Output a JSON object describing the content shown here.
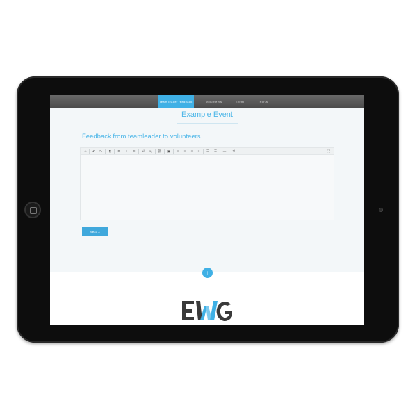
{
  "nav": {
    "items": [
      {
        "label": "Team leader feedback",
        "active": true
      },
      {
        "label": "Volunteers",
        "active": false
      },
      {
        "label": "Event",
        "active": false
      },
      {
        "label": "Portal",
        "active": false
      }
    ]
  },
  "page": {
    "event_title": "Example Event",
    "section_heading": "Feedback from teamleader to volunteers"
  },
  "editor": {
    "toolbar_icons": [
      "code-view-icon",
      "undo-icon",
      "redo-icon",
      "paragraph-icon",
      "bold-icon",
      "italic-icon",
      "strikethrough-icon",
      "superscript-icon",
      "subscript-icon",
      "link-icon",
      "image-icon",
      "align-left-icon",
      "align-center-icon",
      "align-right-icon",
      "align-justify-icon",
      "unordered-list-icon",
      "ordered-list-icon",
      "horizontal-rule-icon",
      "clear-format-icon",
      "fullscreen-icon"
    ],
    "toolbar_glyphs": {
      "code": "‹›",
      "undo": "↶",
      "redo": "↷",
      "paragraph": "¶",
      "bold": "B",
      "italic": "I",
      "strike": "S",
      "superscript": "x²",
      "subscript": "x₂",
      "link": "⛓",
      "image": "▣",
      "align_left": "≡",
      "align_center": "≡",
      "align_right": "≡",
      "align_justify": "≡",
      "ul": "☰",
      "ol": "☰",
      "hr": "—",
      "clear": "T̸",
      "fullscreen": "⛶"
    }
  },
  "actions": {
    "next_label": "Next →"
  },
  "back_to_top": {
    "glyph": "↑"
  },
  "brand": {
    "logo_text": "EWG",
    "colors": {
      "accent": "#3fb0e5",
      "logo_dark": "#3a3a3a",
      "logo_blue": "#3fb0e5"
    }
  }
}
